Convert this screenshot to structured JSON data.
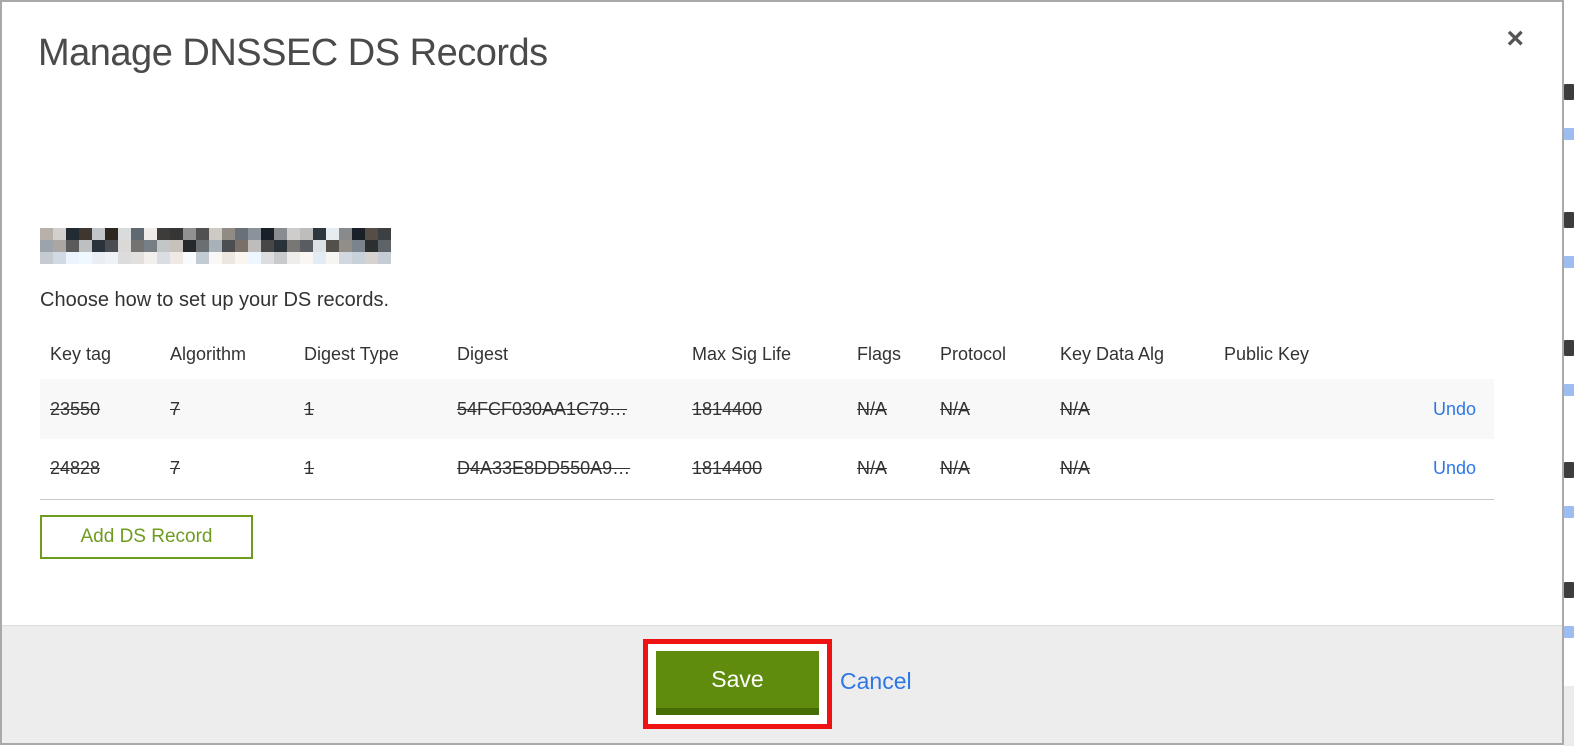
{
  "modal": {
    "title": "Manage DNSSEC DS Records",
    "close_icon": "×",
    "subtitle": "Choose how to set up your DS records.",
    "domain": {
      "redacted": true
    }
  },
  "table": {
    "columns": [
      "Key tag",
      "Algorithm",
      "Digest Type",
      "Digest",
      "Max Sig Life",
      "Flags",
      "Protocol",
      "Key Data Alg",
      "Public Key"
    ],
    "rows": [
      {
        "key_tag": "23550",
        "algorithm": "7",
        "digest_type": "1",
        "digest": "54FCF030AA1C79…",
        "max_sig_life": "1814400",
        "flags": "N/A",
        "protocol": "N/A",
        "key_data_alg": "N/A",
        "public_key": "",
        "action": "Undo",
        "struck": true
      },
      {
        "key_tag": "24828",
        "algorithm": "7",
        "digest_type": "1",
        "digest": "D4A33E8DD550A9…",
        "max_sig_life": "1814400",
        "flags": "N/A",
        "protocol": "N/A",
        "key_data_alg": "N/A",
        "public_key": "",
        "action": "Undo",
        "struck": true
      }
    ]
  },
  "buttons": {
    "add_ds_record": "Add DS Record",
    "save": "Save",
    "cancel": "Cancel"
  },
  "colors": {
    "action_green": "#5f8c0c",
    "outline_green": "#6e9c20",
    "link_blue": "#2e77e5",
    "annotation_red": "#ee1212",
    "modal_border": "#a9a9a9",
    "footer_bg": "#ededed"
  }
}
